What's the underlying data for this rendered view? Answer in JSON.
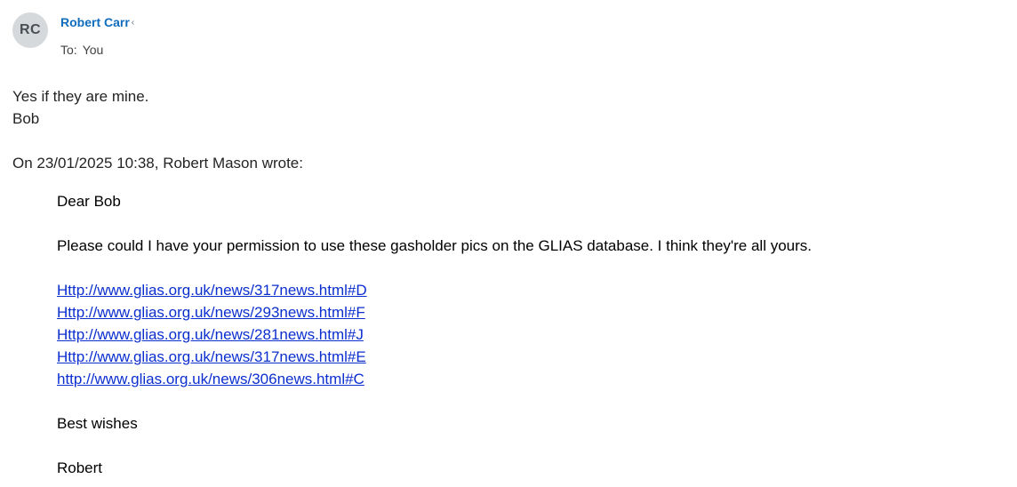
{
  "header": {
    "avatar_initials": "RC",
    "sender_name": "Robert Carr",
    "sender_chevron_icon": "chevron-left-icon",
    "to_label": "To:",
    "to_value": "You"
  },
  "reply": {
    "line1": "Yes if they are mine.",
    "line2": "Bob"
  },
  "quote": {
    "attribution": "On 23/01/2025 10:38, Robert Mason wrote:",
    "greeting": "Dear Bob",
    "request": "Please could I have your permission to use these gasholder pics on the GLIAS database. I think they're all yours.",
    "links": [
      "Http://www.glias.org.uk/news/317news.html#D",
      "Http://www.glias.org.uk/news/293news.html#F",
      "Http://www.glias.org.uk/news/281news.html#J",
      "Http://www.glias.org.uk/news/317news.html#E",
      "http://www.glias.org.uk/news/306news.html#C"
    ],
    "closing": "Best wishes",
    "signature": "Robert"
  },
  "colors": {
    "sender_name": "#0f6cbd",
    "link": "#0b2ecf",
    "avatar_bg": "#d6d9dc"
  }
}
